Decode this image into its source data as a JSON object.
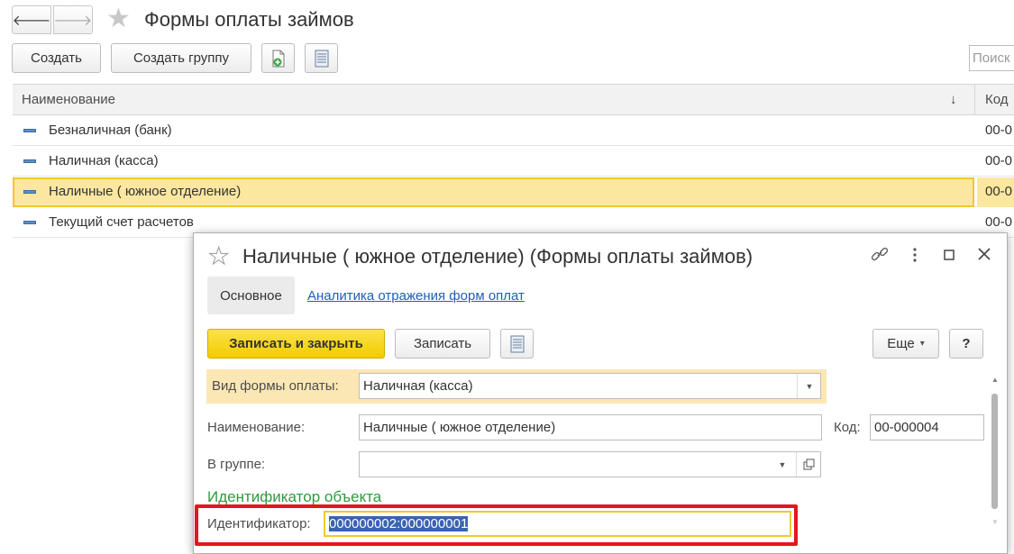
{
  "window": {
    "title": "Формы оплаты займов",
    "nav_back": "🡐",
    "nav_forward": "🡒"
  },
  "toolbar": {
    "create_label": "Создать",
    "create_group_label": "Создать группу",
    "search_placeholder": "Поиск"
  },
  "list": {
    "columns": {
      "name": "Наименование",
      "sort_arrow": "↓",
      "code": "Код"
    },
    "rows": [
      {
        "name": "Безналичная (банк)",
        "code": "00-0"
      },
      {
        "name": "Наличная (касса)",
        "code": "00-0"
      },
      {
        "name": "Наличные ( южное отделение)",
        "code": "00-0"
      },
      {
        "name": "Текущий счет расчетов",
        "code": "00-0"
      }
    ]
  },
  "dialog": {
    "title": "Наличные ( южное отделение) (Формы оплаты займов)",
    "tabs": {
      "main": "Основное",
      "analytics": "Аналитика отражения форм оплат"
    },
    "buttons": {
      "save_close": "Записать и закрыть",
      "save": "Записать",
      "more": "Еще",
      "more_arrow": "▾",
      "help": "?"
    },
    "form": {
      "payment_type_label": "Вид формы оплаты:",
      "payment_type_value": "Наличная (касса)",
      "name_label": "Наименование:",
      "name_value": "Наличные ( южное отделение)",
      "code_label": "Код:",
      "code_value": "00-000004",
      "group_label": "В группе:",
      "group_value": "",
      "section_title": "Идентификатор объекта",
      "identifier_label": "Идентификатор:",
      "identifier_value": "000000002:000000001"
    }
  },
  "colors": {
    "accent_yellow": "#f5d50a",
    "selection_fill": "#fbe7a0",
    "link_blue": "#1f5fb8",
    "section_green": "#2e9a3e",
    "highlight_red": "#e8141c",
    "text_selection": "#3a63b0"
  }
}
